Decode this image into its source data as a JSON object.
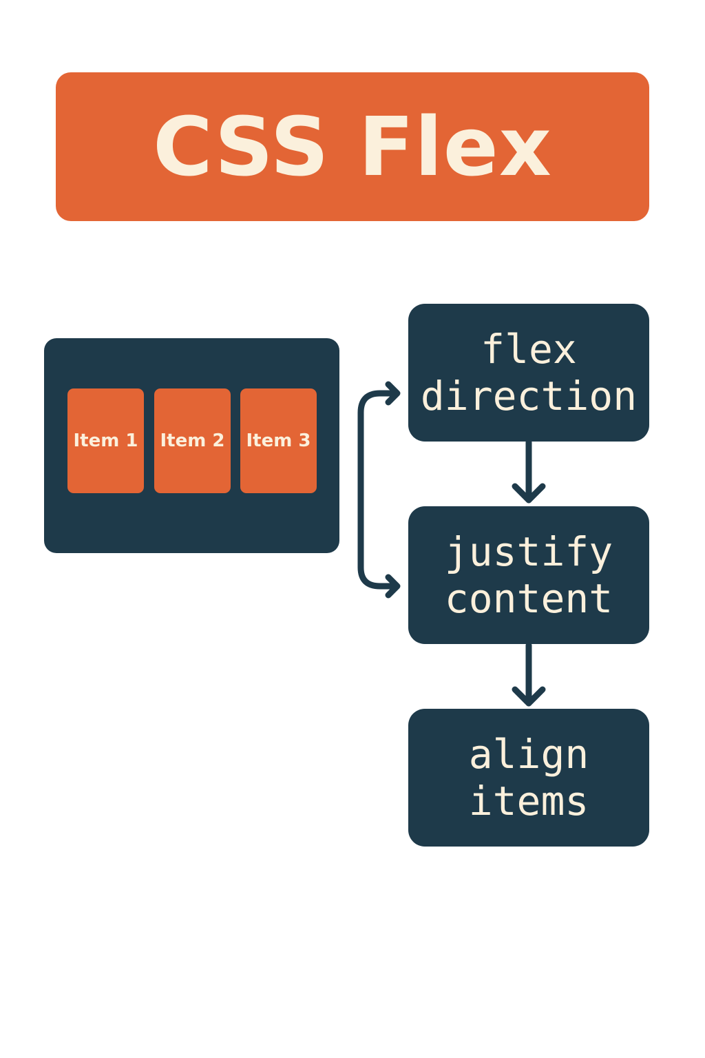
{
  "title": "CSS Flex",
  "container": {
    "items": [
      "Item 1",
      "Item 2",
      "Item 3"
    ]
  },
  "steps": [
    {
      "label": "flex\ndirection"
    },
    {
      "label": "justify\ncontent"
    },
    {
      "label": "align\nitems"
    }
  ],
  "colors": {
    "accent": "#e36535",
    "dark": "#1e3a4a",
    "text_light": "#fbf0dc",
    "background": "#ffffff"
  }
}
